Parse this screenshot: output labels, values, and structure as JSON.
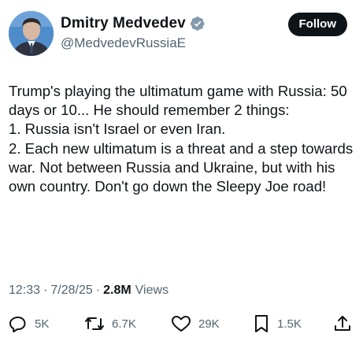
{
  "author": {
    "display_name": "Dmitry Medvedev",
    "handle": "@MedvedevRussiaE",
    "verified": true
  },
  "follow_label": "Follow",
  "tweet_text": "Trump's playing the ultimatum game with Russia: 50 days or 10... He should remember 2 things:\n1. Russia isn't Israel or even Iran.\n2. Each new ultimatum is a threat and a step towards war. Not between Russia and Ukraine, but with his own country. Don't go down the Sleepy Joe road!",
  "meta": {
    "time": "12:33",
    "date": "7/28/25",
    "views_count": "2.8M",
    "views_label": "Views"
  },
  "actions": {
    "replies": "5K",
    "reposts": "6.7K",
    "likes": "29K",
    "bookmarks": "1.5K"
  },
  "icons": {
    "verified": "verified-badge-icon",
    "reply": "reply-icon",
    "repost": "repost-icon",
    "like": "heart-icon",
    "bookmark": "bookmark-icon",
    "share": "share-icon"
  },
  "colors": {
    "text": "#0f1419",
    "secondary": "#536471",
    "verified_badge": "#829aab",
    "follow_button_bg": "#0f1419",
    "follow_button_text": "#ffffff"
  }
}
